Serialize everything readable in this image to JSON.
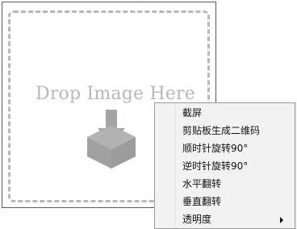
{
  "drop_area": {
    "text": "Drop Image Here",
    "icon": "download-tray-icon"
  },
  "context_menu": {
    "items": [
      {
        "label": "截屏"
      },
      {
        "label": "剪贴板生成二维码"
      },
      {
        "label": "顺时针旋转90°"
      },
      {
        "label": "逆时针旋转90°"
      },
      {
        "label": "水平翻转"
      },
      {
        "label": "垂直翻转"
      },
      {
        "label": "透明度",
        "submenu": true
      }
    ]
  },
  "colors": {
    "drop_text": "#b8b8b8",
    "icon_gray": "#a3a3a3",
    "menu_background": "#f2f2f2",
    "menu_border": "#9a9a9a"
  }
}
